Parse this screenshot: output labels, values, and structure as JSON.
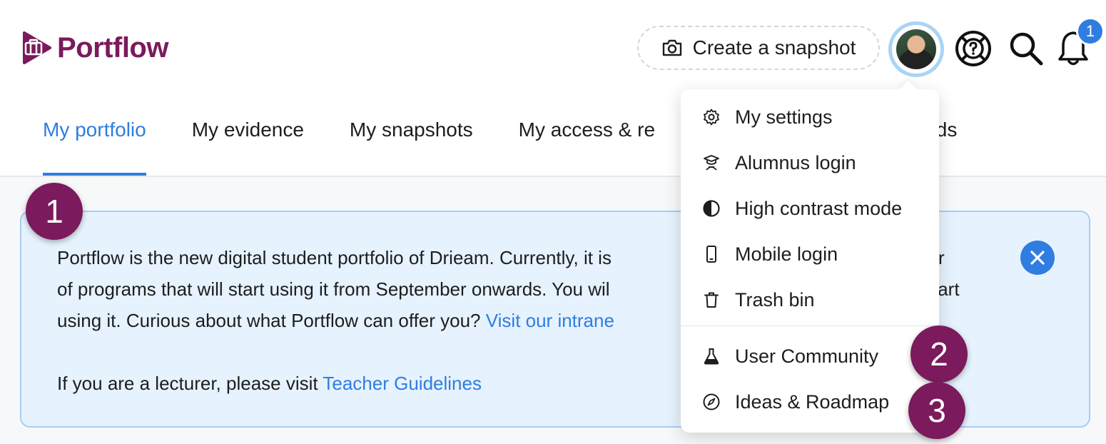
{
  "header": {
    "logo_text": "Portflow",
    "snapshot_button": "Create a snapshot",
    "notification_count": "1",
    "icons": [
      "camera-icon",
      "help-lifebuoy-icon",
      "search-icon",
      "bell-icon"
    ]
  },
  "tabs": [
    {
      "label": "My portfolio",
      "active": true
    },
    {
      "label": "My evidence"
    },
    {
      "label": "My snapshots"
    },
    {
      "label": "My access & re"
    },
    {
      "label": "olds"
    }
  ],
  "banner": {
    "line1": "Portflow is the new digital student portfolio of Drieam. Currently, it is",
    "line1_tail": "umber",
    "line2": "of programs that will start using it from September onwards. You wil",
    "line2_tail": "tart",
    "line3": "using it. Curious about what Portflow can offer you?",
    "intranet_link": "Visit our intrane",
    "lecturer_text": "If you are a lecturer, please visit",
    "teacher_link": "Teacher Guidelines"
  },
  "dropdown": {
    "items": [
      {
        "label": "My settings",
        "icon": "gear-icon"
      },
      {
        "label": "Alumnus login",
        "icon": "graduate-icon"
      },
      {
        "label": "High contrast mode",
        "icon": "contrast-icon"
      },
      {
        "label": "Mobile login",
        "icon": "mobile-icon"
      },
      {
        "label": "Trash bin",
        "icon": "trash-icon"
      }
    ],
    "secondary_items": [
      {
        "label": "User Community",
        "icon": "flask-icon"
      },
      {
        "label": "Ideas & Roadmap",
        "icon": "compass-icon"
      }
    ]
  },
  "steps": [
    "1",
    "2",
    "3"
  ],
  "colors": {
    "brand": "#7b1a5c",
    "accent": "#2f7de1",
    "banner_bg": "#e6f2fd"
  }
}
